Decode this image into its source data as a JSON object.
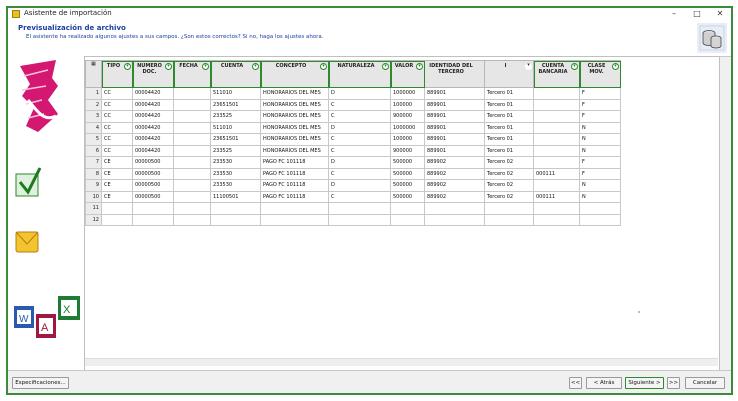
{
  "window": {
    "title": "Asistente de importación",
    "minimize": "–",
    "maximize": "□",
    "close": "✕"
  },
  "header": {
    "title": "Previsualización de archivo",
    "subtitle": "El asistente ha realizado algunos ajustes a sus campos. ¿Son estos correctos? Si no, haga los ajustes ahora."
  },
  "grid": {
    "columns": [
      {
        "label": "TIPO"
      },
      {
        "label": "NUMERO DOC."
      },
      {
        "label": "FECHA"
      },
      {
        "label": "CUENTA"
      },
      {
        "label": "CONCEPTO"
      },
      {
        "label": "NATURALEZA"
      },
      {
        "label": "VALOR"
      },
      {
        "label": "IDENTIDAD DEL TERCERO"
      },
      {
        "label": "I"
      },
      {
        "label": "CUENTA BANCARIA"
      },
      {
        "label": "CLASE MOV."
      }
    ],
    "rows": [
      {
        "n": "1",
        "c": [
          "CC",
          "00004420",
          "",
          "511010",
          "HONORARIOS DEL MES",
          "D",
          "1000000",
          "889901",
          "Tercero 01",
          "",
          "F"
        ]
      },
      {
        "n": "2",
        "c": [
          "CC",
          "00004420",
          "",
          "23651501",
          "HONORARIOS DEL MES",
          "C",
          "100000",
          "889901",
          "Tercero 01",
          "",
          "F"
        ]
      },
      {
        "n": "3",
        "c": [
          "CC",
          "00004420",
          "",
          "233525",
          "HONORARIOS DEL MES",
          "C",
          "900000",
          "889901",
          "Tercero 01",
          "",
          "F"
        ]
      },
      {
        "n": "4",
        "c": [
          "CC",
          "00004420",
          "",
          "511010",
          "HONORARIOS DEL MES",
          "D",
          "1000000",
          "889901",
          "Tercero 01",
          "",
          "N"
        ]
      },
      {
        "n": "5",
        "c": [
          "CC",
          "00004420",
          "",
          "23651501",
          "HONORARIOS DEL MES",
          "C",
          "100000",
          "889901",
          "Tercero 01",
          "",
          "N"
        ]
      },
      {
        "n": "6",
        "c": [
          "CC",
          "00004420",
          "",
          "233525",
          "HONORARIOS DEL MES",
          "C",
          "900000",
          "889901",
          "Tercero 01",
          "",
          "N"
        ]
      },
      {
        "n": "7",
        "c": [
          "CE",
          "00000500",
          "",
          "233530",
          "PAGO FC 101118",
          "D",
          "500000",
          "889902",
          "Tercero 02",
          "",
          "F"
        ]
      },
      {
        "n": "8",
        "c": [
          "CE",
          "00000500",
          "",
          "233530",
          "PAGO FC 101118",
          "C",
          "500000",
          "889902",
          "Tercero 02",
          "000111",
          "F"
        ]
      },
      {
        "n": "9",
        "c": [
          "CE",
          "00000500",
          "",
          "233530",
          "PAGO FC 101118",
          "D",
          "500000",
          "889902",
          "Tercero 02",
          "",
          "N"
        ]
      },
      {
        "n": "10",
        "c": [
          "CE",
          "00000500",
          "",
          "11100501",
          "PAGO FC 101118",
          "C",
          "500000",
          "889902",
          "Tercero 02",
          "000111",
          "N"
        ]
      },
      {
        "n": "11",
        "c": [
          "",
          "",
          "",
          "",
          "",
          "",
          "",
          "",
          "",
          "",
          ""
        ]
      },
      {
        "n": "12",
        "c": [
          "",
          "",
          "",
          "",
          "",
          "",
          "",
          "",
          "",
          "",
          ""
        ]
      }
    ]
  },
  "footer": {
    "spec_button": "Especificaciones...",
    "first_button": "<<",
    "back_button": "< Atrás",
    "next_button": "Siguiente >",
    "last_button": ">>",
    "cancel_button": "Cancelar"
  },
  "colors": {
    "accent": "#2f8a2f",
    "title_blue": "#1a3fa0"
  }
}
